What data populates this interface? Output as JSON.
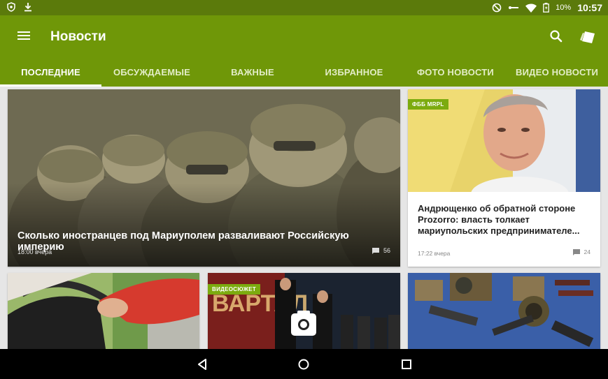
{
  "status_bar": {
    "left_icons": [
      "shield-icon",
      "download-icon"
    ],
    "right_icons": [
      "do-not-disturb-icon",
      "key-icon",
      "wifi-icon",
      "battery-icon"
    ],
    "battery": "10%",
    "time": "10:57"
  },
  "app_bar": {
    "title": "Новости",
    "icons": [
      "menu-icon",
      "search-icon",
      "cards-icon"
    ]
  },
  "tabs": [
    {
      "label": "ПОСЛЕДНИЕ",
      "active": true
    },
    {
      "label": "ОБСУЖДАЕМЫЕ",
      "active": false
    },
    {
      "label": "ВАЖНЫЕ",
      "active": false
    },
    {
      "label": "ИЗБРАННОЕ",
      "active": false
    },
    {
      "label": "ФОТО НОВОСТИ",
      "active": false
    },
    {
      "label": "ВИДЕО НОВОСТИ",
      "active": false
    }
  ],
  "cards": {
    "hero": {
      "headline": "Сколько иностранцев под Мариуполем разваливают Российскую империю",
      "time": "18:00 вчера",
      "comments": "56"
    },
    "side": {
      "badge": "ФББ MRPL",
      "headline": "Андрющенко об обратной стороне Prozorro: власть толкает мариупольских предпринимателе...",
      "time": "17:22 вчера",
      "comments": "24"
    },
    "video": {
      "badge": "ВИДЕОСЮЖЕТ",
      "overlay_icon": "camera-icon"
    }
  },
  "nav_bar": {
    "icons": [
      "back-icon",
      "home-icon",
      "recents-icon"
    ]
  },
  "colors": {
    "status_bar": "#5b7a0b",
    "app_bar": "#6f9708",
    "badge": "#7cab0f",
    "background": "#e6e6e6"
  }
}
